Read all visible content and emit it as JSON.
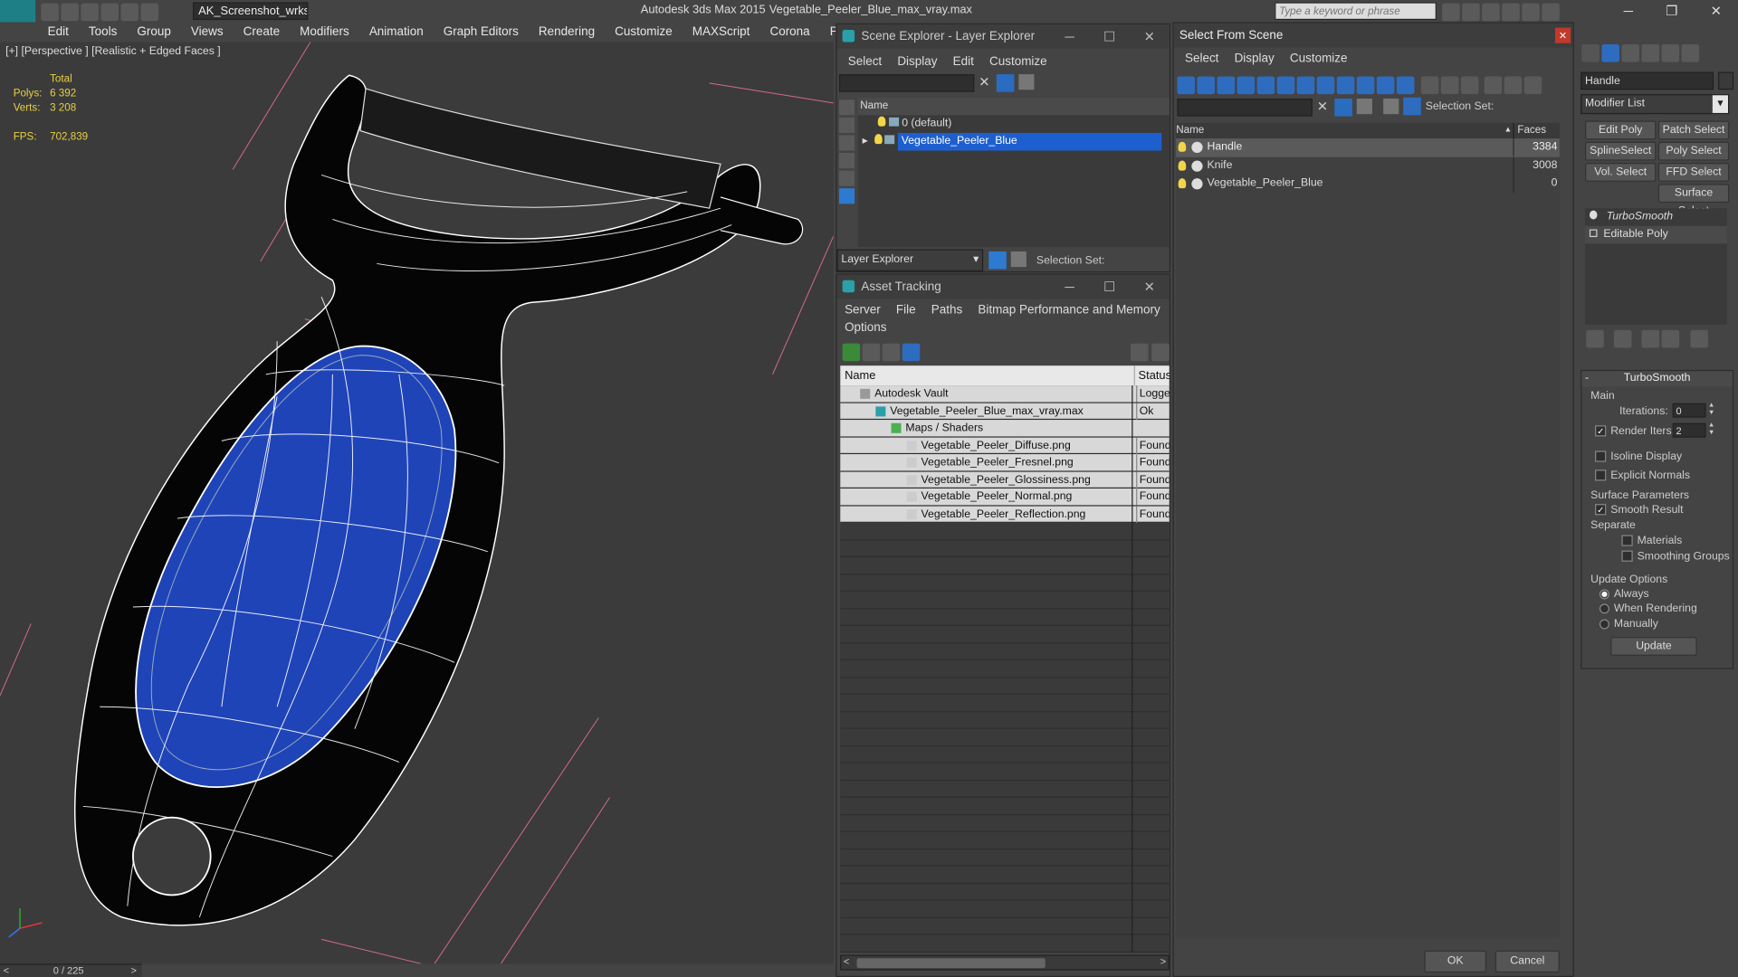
{
  "title": {
    "workspace": "AK_Screenshot_wrksp",
    "app": "Autodesk 3ds Max  2015",
    "file": "Vegetable_Peeler_Blue_max_vray.max",
    "search_placeholder": "Type a keyword or phrase",
    "logo": "MAX"
  },
  "menus": [
    "Edit",
    "Tools",
    "Group",
    "Views",
    "Create",
    "Modifiers",
    "Animation",
    "Graph Editors",
    "Rendering",
    "Customize",
    "MAXScript",
    "Corona",
    "Project Man"
  ],
  "viewport": {
    "label": "[+] [Perspective ] [Realistic + Edged Faces ]",
    "stats": {
      "total_label": "Total",
      "polys_label": "Polys:",
      "polys": "6 392",
      "verts_label": "Verts:",
      "verts": "3 208",
      "fps_label": "FPS:",
      "fps": "702,839"
    },
    "timeline": "0 / 225"
  },
  "scene_explorer": {
    "title": "Scene Explorer - Layer Explorer",
    "menus": [
      "Select",
      "Display",
      "Edit",
      "Customize"
    ],
    "col_name": "Name",
    "layers": [
      "0 (default)",
      "Vegetable_Peeler_Blue"
    ],
    "footer_mode": "Layer Explorer",
    "footer_selset": "Selection Set:"
  },
  "asset_tracking": {
    "title": "Asset Tracking",
    "menus": [
      "Server",
      "File",
      "Paths",
      "Bitmap Performance and Memory"
    ],
    "menu2": "Options",
    "col_name": "Name",
    "col_status": "Status",
    "rows": [
      {
        "name": "Autodesk Vault",
        "status": "Logged"
      },
      {
        "name": "Vegetable_Peeler_Blue_max_vray.max",
        "status": "Ok"
      },
      {
        "name": "Maps / Shaders",
        "status": ""
      },
      {
        "name": "Vegetable_Peeler_Diffuse.png",
        "status": "Found"
      },
      {
        "name": "Vegetable_Peeler_Fresnel.png",
        "status": "Found"
      },
      {
        "name": "Vegetable_Peeler_Glossiness.png",
        "status": "Found"
      },
      {
        "name": "Vegetable_Peeler_Normal.png",
        "status": "Found"
      },
      {
        "name": "Vegetable_Peeler_Reflection.png",
        "status": "Found"
      }
    ]
  },
  "select_from_scene": {
    "title": "Select From Scene",
    "menus": [
      "Select",
      "Display",
      "Customize"
    ],
    "selset": "Selection Set:",
    "col_name": "Name",
    "col_faces": "Faces",
    "rows": [
      {
        "name": "Handle",
        "faces": "3384"
      },
      {
        "name": "Knife",
        "faces": "3008"
      },
      {
        "name": "Vegetable_Peeler_Blue",
        "faces": "0"
      }
    ],
    "ok": "OK",
    "cancel": "Cancel"
  },
  "command_panel": {
    "object_name": "Handle",
    "modifier_list": "Modifier List",
    "buttons": [
      "Edit Poly",
      "Patch Select",
      "SplineSelect",
      "Poly Select",
      "Vol. Select",
      "FFD Select",
      "Surface Select"
    ],
    "stack": [
      "TurboSmooth",
      "Editable Poly"
    ],
    "rollout": "TurboSmooth",
    "main": "Main",
    "iterations_label": "Iterations:",
    "iterations": "0",
    "render_iters_label": "Render Iters:",
    "render_iters": "2",
    "isoline": "Isoline Display",
    "explicit": "Explicit Normals",
    "surface_params": "Surface Parameters",
    "smooth_result": "Smooth Result",
    "separate": "Separate",
    "materials": "Materials",
    "smoothing_groups": "Smoothing Groups",
    "update_options": "Update Options",
    "always": "Always",
    "when_rendering": "When Rendering",
    "manually": "Manually",
    "update": "Update"
  }
}
